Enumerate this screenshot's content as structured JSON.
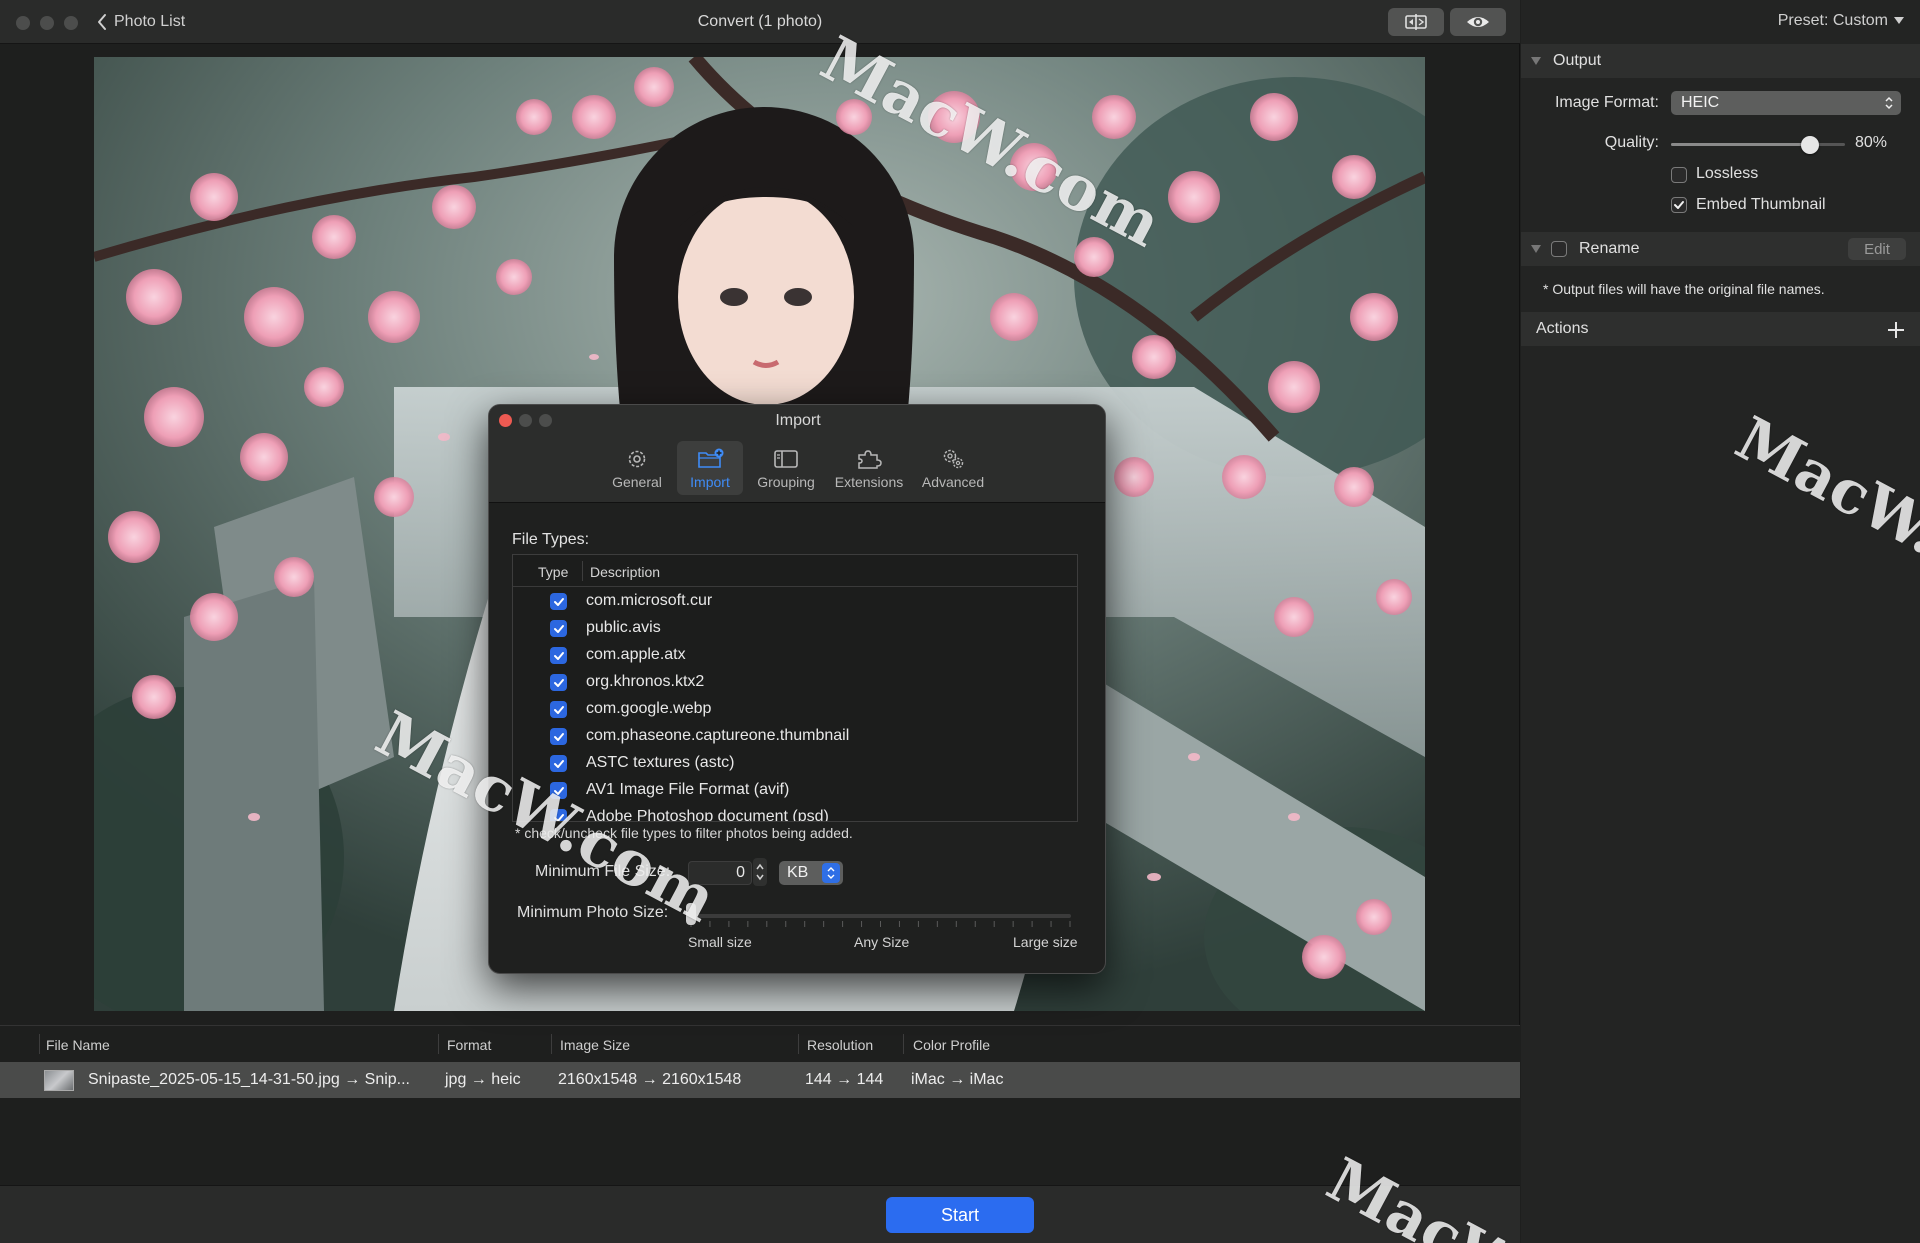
{
  "titlebar": {
    "back_label": "Photo List",
    "title": "Convert (1 photo)"
  },
  "sidebar": {
    "preset_label": "Preset: Custom",
    "output": {
      "title": "Output",
      "image_format_label": "Image Format:",
      "image_format_value": "HEIC",
      "quality_label": "Quality:",
      "quality_value": "80%",
      "quality_level": 0.8,
      "lossless_label": "Lossless",
      "lossless_checked": false,
      "embed_thumbnail_label": "Embed Thumbnail",
      "embed_thumbnail_checked": true
    },
    "rename": {
      "title": "Rename",
      "checked": false,
      "edit_label": "Edit",
      "note": "* Output files will have the original file names."
    },
    "actions": {
      "title": "Actions"
    }
  },
  "dialog": {
    "title": "Import",
    "tabs": [
      {
        "label": "General",
        "icon": "gear-icon"
      },
      {
        "label": "Import",
        "icon": "folder-plus-icon",
        "selected": true
      },
      {
        "label": "Grouping",
        "icon": "sidebar-panel-icon"
      },
      {
        "label": "Extensions",
        "icon": "puzzle-icon"
      },
      {
        "label": "Advanced",
        "icon": "gears-icon"
      }
    ],
    "file_types_label": "File Types:",
    "table_headers": {
      "type": "Type",
      "description": "Description"
    },
    "file_types": [
      {
        "checked": true,
        "description": "com.microsoft.cur"
      },
      {
        "checked": true,
        "description": "public.avis"
      },
      {
        "checked": true,
        "description": "com.apple.atx"
      },
      {
        "checked": true,
        "description": "org.khronos.ktx2"
      },
      {
        "checked": true,
        "description": "com.google.webp"
      },
      {
        "checked": true,
        "description": "com.phaseone.captureone.thumbnail"
      },
      {
        "checked": true,
        "description": "ASTC textures (astc)"
      },
      {
        "checked": true,
        "description": "AV1 Image File Format (avif)"
      },
      {
        "checked": true,
        "description": "Adobe Photoshop document (psd)"
      }
    ],
    "note": "* check/uncheck file types to filter photos being added.",
    "min_file_size_label": "Minimum File Size:",
    "min_file_size_value": "0",
    "min_file_size_unit": "KB",
    "min_photo_size_label": "Minimum Photo Size:",
    "slider_labels": {
      "small": "Small size",
      "any": "Any Size",
      "large": "Large size"
    }
  },
  "file_table": {
    "headers": [
      "File Name",
      "Format",
      "Image Size",
      "Resolution",
      "Color Profile"
    ],
    "rows": [
      {
        "file_name": "Snipaste_2025-05-15_14-31-50.jpg → Snip...",
        "format": "jpg → heic",
        "image_size": "2160x1548 → 2160x1548",
        "resolution": "144 → 144",
        "color_profile": "iMac → iMac"
      }
    ]
  },
  "bottom": {
    "start_label": "Start"
  },
  "watermarks": [
    "MacW.com",
    "MacW.com",
    "MacW.c",
    "MacW"
  ],
  "colors": {
    "accent": "#2b6cf0",
    "checkbox": "#2c67e0",
    "selected_tab": "#3f8cf7",
    "close_button": "#ed5a52"
  }
}
